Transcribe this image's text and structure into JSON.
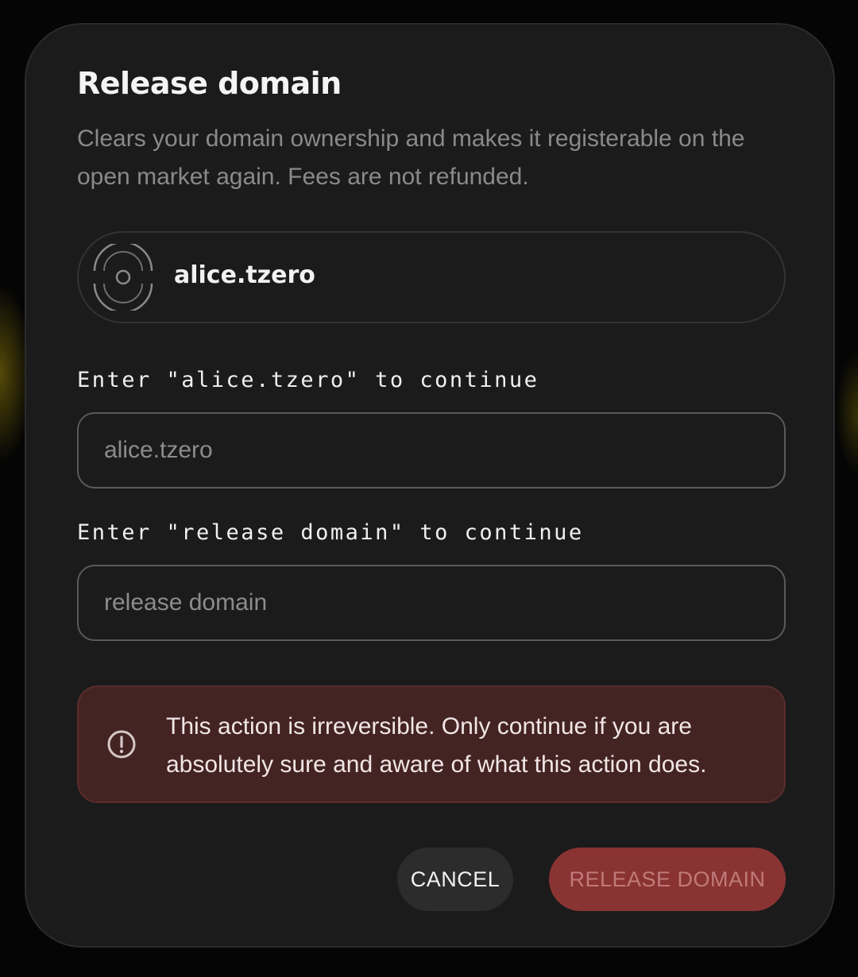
{
  "dialog": {
    "title": "Release domain",
    "description": "Clears your domain ownership and makes it registerable on the open market again. Fees are not refunded."
  },
  "domain": {
    "name": "alice.tzero",
    "icon": "domain-avatar-icon"
  },
  "fields": [
    {
      "label": "Enter \"alice.tzero\" to continue",
      "placeholder": "alice.tzero",
      "value": ""
    },
    {
      "label": "Enter \"release domain\" to continue",
      "placeholder": "release domain",
      "value": ""
    }
  ],
  "warning": {
    "icon": "alert-circle-icon",
    "text": "This action is irreversible. Only continue if you are absolutely sure and aware of what this action does."
  },
  "actions": {
    "cancel_label": "CANCEL",
    "release_label": "RELEASE DOMAIN"
  },
  "colors": {
    "modal_bg": "#1b1b1b",
    "warning_bg": "#442423",
    "danger_button": "#8a3333",
    "danger_button_text": "#c07a7a"
  }
}
